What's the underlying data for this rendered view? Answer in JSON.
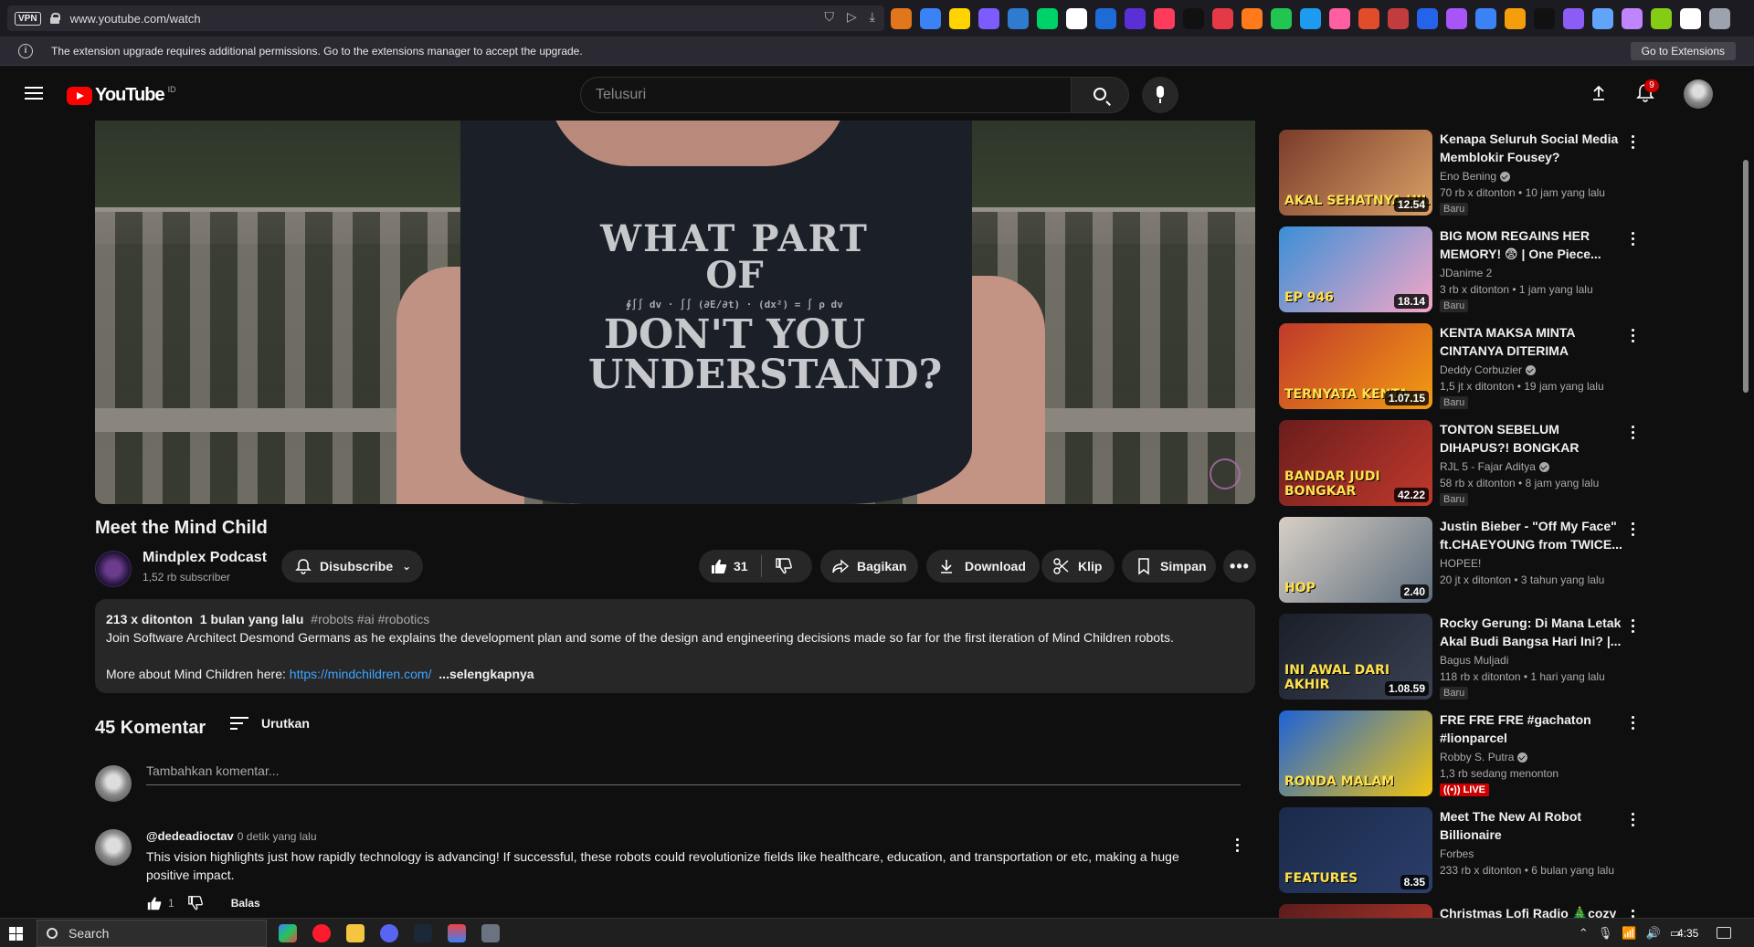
{
  "browser": {
    "vpn_label": "VPN",
    "url": "www.youtube.com/watch",
    "extension_colors": [
      "#e2761b",
      "#3b82f6",
      "#ffd400",
      "#7c5cff",
      "#2e7bcf",
      "#00d26a",
      "#ffffff",
      "#1e6ad6",
      "#5b2fd6",
      "#ff3b5c",
      "#111111",
      "#e63946",
      "#ff7a1a",
      "#23c552",
      "#1c9bf0",
      "#ff5fa2",
      "#e14d2a",
      "#c13c3c",
      "#2563eb",
      "#a855f7",
      "#3b82f6",
      "#f59e0b",
      "#111111",
      "#8b5cf6",
      "#60a5fa",
      "#c084fc",
      "#84cc16",
      "#ffffff",
      "#9ca3af"
    ]
  },
  "notice": {
    "message": "The extension upgrade requires additional permissions. Go to the extensions manager to accept the upgrade.",
    "button": "Go to Extensions"
  },
  "header": {
    "logo_text": "YouTube",
    "country": "ID",
    "search_placeholder": "Telusuri",
    "notifications": "9"
  },
  "video": {
    "shirt_line1": "WHAT PART",
    "shirt_line2": "OF",
    "shirt_line3": "∮∫∫ dv · ∫∫ (∂E/∂t) · (dx²) = ∫ ρ dv",
    "shirt_line4": "DON'T YOU UNDERSTAND?",
    "title": "Meet the Mind Child",
    "channel_name": "Mindplex Podcast",
    "subscribers": "1,52 rb subscriber",
    "subscribe_label": "Disubscribe",
    "likes": "31",
    "share_label": "Bagikan",
    "download_label": "Download",
    "clip_label": "Klip",
    "save_label": "Simpan"
  },
  "description": {
    "views": "213 x ditonton",
    "date": "1 bulan yang lalu",
    "tags": "#robots #ai #robotics",
    "text": "Join Software Architect Desmond Germans as he explains the development plan and some of the design and engineering decisions made so far for the first iteration of Mind Children robots.",
    "more_prefix": "More about Mind Children here: ",
    "link": "https://mindchildren.com/",
    "more_label": "...selengkapnya"
  },
  "comments": {
    "count_label": "45 Komentar",
    "sort_label": "Urutkan",
    "add_placeholder": "Tambahkan komentar...",
    "items": [
      {
        "author": "@dedeadioctav",
        "time": "0 detik yang lalu",
        "text": "This vision highlights just how rapidly technology is advancing! If successful, these robots could revolutionize fields like healthcare, education, and transportation or etc, making a huge positive impact.",
        "likes": "1",
        "reply_label": "Balas"
      }
    ]
  },
  "sidebar": {
    "items": [
      {
        "title": "Kenapa Seluruh Social Media Memblokir Fousey?",
        "channel": "Eno Bening",
        "verified": true,
        "meta": "70 rb x ditonton • 10 jam yang lalu",
        "badge": "Baru",
        "duration": "12.54",
        "caption": "AKAL SEHATNYA HIL",
        "colors": [
          "#7a3b2a",
          "#d9a066"
        ]
      },
      {
        "title": "BIG MOM REGAINS HER MEMORY! 😨 | One Piece...",
        "channel": "JDanime 2",
        "verified": false,
        "meta": "3 rb x ditonton • 1 jam yang lalu",
        "badge": "Baru",
        "duration": "18.14",
        "caption": "EP 946",
        "colors": [
          "#3a8fd6",
          "#f4a6c6"
        ]
      },
      {
        "title": "KENTA MAKSA MINTA CINTANYA DITERIMA HARUK...",
        "channel": "Deddy Corbuzier",
        "verified": true,
        "meta": "1,5 jt x ditonton • 19 jam yang lalu",
        "badge": "Baru",
        "duration": "1.07.15",
        "caption": "TERNYATA KENTA",
        "colors": [
          "#c0392b",
          "#f39c12"
        ]
      },
      {
        "title": "TONTON SEBELUM DIHAPUS?! BONGKAR SETTINGAN JUDI...",
        "channel": "RJL 5 - Fajar Aditya",
        "verified": true,
        "meta": "58 rb x ditonton • 8 jam yang lalu",
        "badge": "Baru",
        "duration": "42.22",
        "caption": "BANDAR JUDI BONGKAR",
        "colors": [
          "#6b1d1d",
          "#c0392b"
        ]
      },
      {
        "title": "Justin Bieber - \"Off My Face\" ft.CHAEYOUNG from TWICE...",
        "channel": "HOPEE!",
        "verified": false,
        "meta": "20 jt x ditonton • 3 tahun yang lalu",
        "badge": "",
        "duration": "2.40",
        "caption": "HOP",
        "colors": [
          "#d8cfc4",
          "#5d6d7e"
        ]
      },
      {
        "title": "Rocky Gerung: Di Mana Letak Akal Budi Bangsa Hari Ini? |...",
        "channel": "Bagus Muljadi",
        "verified": false,
        "meta": "118 rb x ditonton • 1 hari yang lalu",
        "badge": "Baru",
        "duration": "1.08.59",
        "caption": "INI AWAL DARI AKHIR",
        "colors": [
          "#1b1f2a",
          "#3a4152"
        ]
      },
      {
        "title": "FRE FRE FRE #gachaton #lionparcel",
        "channel": "Robby S. Putra",
        "verified": true,
        "meta": "1,3 rb sedang menonton",
        "badge": "LIVE",
        "duration": "",
        "caption": "RONDA MALAM",
        "colors": [
          "#1e63d6",
          "#f1c40f"
        ]
      },
      {
        "title": "Meet The New AI Robot Billionaire",
        "channel": "Forbes",
        "verified": false,
        "meta": "233 rb x ditonton • 6 bulan yang lalu",
        "badge": "",
        "duration": "8.35",
        "caption": "FEATURES",
        "colors": [
          "#1a2a4a",
          "#2c3e6a"
        ]
      },
      {
        "title": "Christmas Lofi Radio 🎄cozy",
        "channel": "",
        "verified": false,
        "meta": "",
        "badge": "",
        "duration": "",
        "caption": "",
        "colors": [
          "#5a1d1d",
          "#c0392b"
        ]
      }
    ]
  },
  "taskbar": {
    "search_label": "Search",
    "clock": "4:35"
  }
}
